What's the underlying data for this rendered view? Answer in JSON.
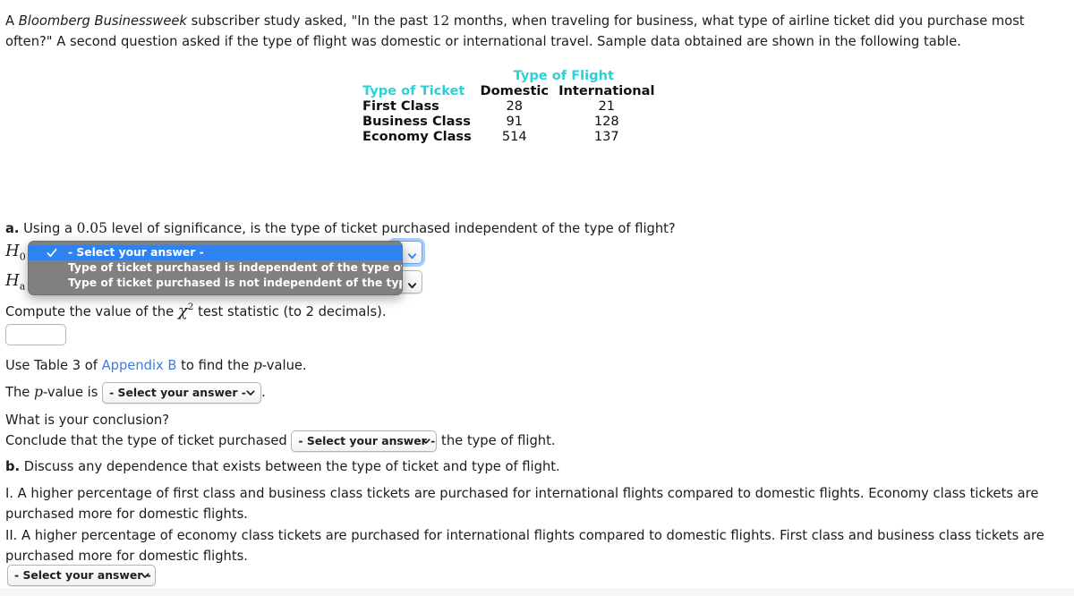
{
  "intro": {
    "part1": "A ",
    "publication": "Bloomberg Businessweek",
    "part2": " subscriber study asked, \"In the past ",
    "months": "12",
    "part3": " months, when traveling for business, what type of airline ticket did you purchase most often?\" A second question asked if the type of flight was domestic or international travel. Sample data obtained are shown in the following table."
  },
  "table": {
    "flight_header": "Type of Flight",
    "ticket_header": "Type of Ticket",
    "columns": [
      "Domestic",
      "International"
    ],
    "rows": [
      {
        "label": "First Class",
        "domestic": "28",
        "international": "21"
      },
      {
        "label": "Business Class",
        "domestic": "91",
        "international": "128"
      },
      {
        "label": "Economy Class",
        "domestic": "514",
        "international": "137"
      }
    ]
  },
  "part_a": {
    "marker": "a.",
    "text_before": " Using a ",
    "alpha": "0.05",
    "text_after": " level of significance, is the type of ticket purchased independent of the type of flight?",
    "h0_label": "H",
    "h0_sub": "0",
    "ha_label": "H",
    "ha_sub": "a"
  },
  "dropdown_open": {
    "options": [
      "- Select your answer -",
      "Type of ticket purchased is independent of the type of flight",
      "Type of ticket purchased is not independent of the type of flight"
    ],
    "selected_index": 0,
    "check_icon": "check-icon",
    "highlight_color": "#2f83f1",
    "background_color": "#808080"
  },
  "chi_square": {
    "text_before": "Compute the value of the ",
    "symbol": "χ",
    "exponent": "2",
    "text_after": " test statistic (to 2 decimals).",
    "input_value": "",
    "input_placeholder": ""
  },
  "p_value": {
    "line1_before": "Use Table 3 of ",
    "link_text": "Appendix B",
    "line1_after": " to find the ",
    "p_italic": "p",
    "line1_end": "-value.",
    "line2_before": "The ",
    "line2_p": "p",
    "line2_mid": "-value is ",
    "select_label": "- Select your answer -",
    "line2_end": "."
  },
  "conclusion": {
    "question": "What is your conclusion?",
    "before": "Conclude that the type of ticket purchased ",
    "select_label": "- Select your answer -",
    "after": " the type of flight."
  },
  "part_b": {
    "marker": "b.",
    "text": " Discuss any dependence that exists between the type of ticket and type of flight.",
    "statement_I": "I. A higher percentage of first class and business class tickets are purchased for international flights compared to domestic flights. Economy class tickets are purchased more for domestic flights.",
    "statement_II": "II. A higher percentage of economy class tickets are purchased for international flights compared to domestic flights. First class and business class tickets are purchased more for domestic flights.",
    "select_label": "- Select your answer -"
  },
  "colors": {
    "teal_header": "#2ed0d7",
    "link_blue": "#3b7ddd",
    "selection_blue": "#2f83f1",
    "popup_gray": "#808080"
  }
}
